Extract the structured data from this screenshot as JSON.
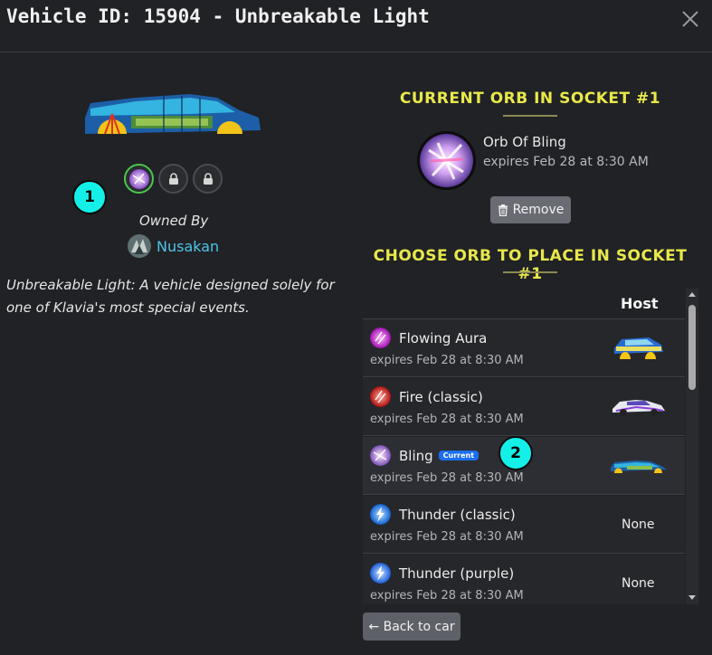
{
  "modal": {
    "title": "Vehicle ID: 15904 - Unbreakable Light",
    "close_icon": "close-icon"
  },
  "vehicle": {
    "owned_by_label": "Owned By",
    "owner_name": "Nusakan",
    "description": "Unbreakable Light: A vehicle designed solely for one of Klavia's most special events.",
    "sockets": [
      {
        "state": "filled",
        "icon": "bling-orb-icon"
      },
      {
        "state": "locked",
        "icon": "lock-icon"
      },
      {
        "state": "locked",
        "icon": "lock-icon"
      }
    ]
  },
  "annotations": {
    "badge_1": "1",
    "badge_2": "2"
  },
  "current_orb": {
    "heading": "CURRENT ORB IN SOCKET #1",
    "name": "Orb Of Bling",
    "expires": "expires Feb 28 at 8:30 AM",
    "remove_label": "Remove"
  },
  "choose": {
    "heading": "CHOOSE ORB TO PLACE IN SOCKET #1",
    "host_header": "Host",
    "current_tag": "Current",
    "none_text": "None",
    "rows": [
      {
        "name": "Flowing Aura",
        "expires": "expires Feb 28 at 8:30 AM",
        "orb_color": "#c020c8",
        "host": "car"
      },
      {
        "name": "Fire (classic)",
        "expires": "expires Feb 28 at 8:30 AM",
        "orb_color": "#e02020",
        "host": "car"
      },
      {
        "name": "Bling",
        "expires": "expires Feb 28 at 8:30 AM",
        "orb_color": "#a878d8",
        "host": "car",
        "current": true
      },
      {
        "name": "Thunder (classic)",
        "expires": "expires Feb 28 at 8:30 AM",
        "orb_color": "#2d8cf0",
        "host": "None"
      },
      {
        "name": "Thunder (purple)",
        "expires": "expires Feb 28 at 8:30 AM",
        "orb_color": "#2d8cf0",
        "host": "None"
      }
    ]
  },
  "footer": {
    "back_label": "← Back to car"
  },
  "colors": {
    "background": "#212226",
    "heading_yellow": "#e8e84a",
    "link_cyan": "#4fc4e8",
    "badge_cyan": "#14f0e8",
    "current_tag_blue": "#1a6ff0",
    "socket_active_green": "#49c84a"
  }
}
